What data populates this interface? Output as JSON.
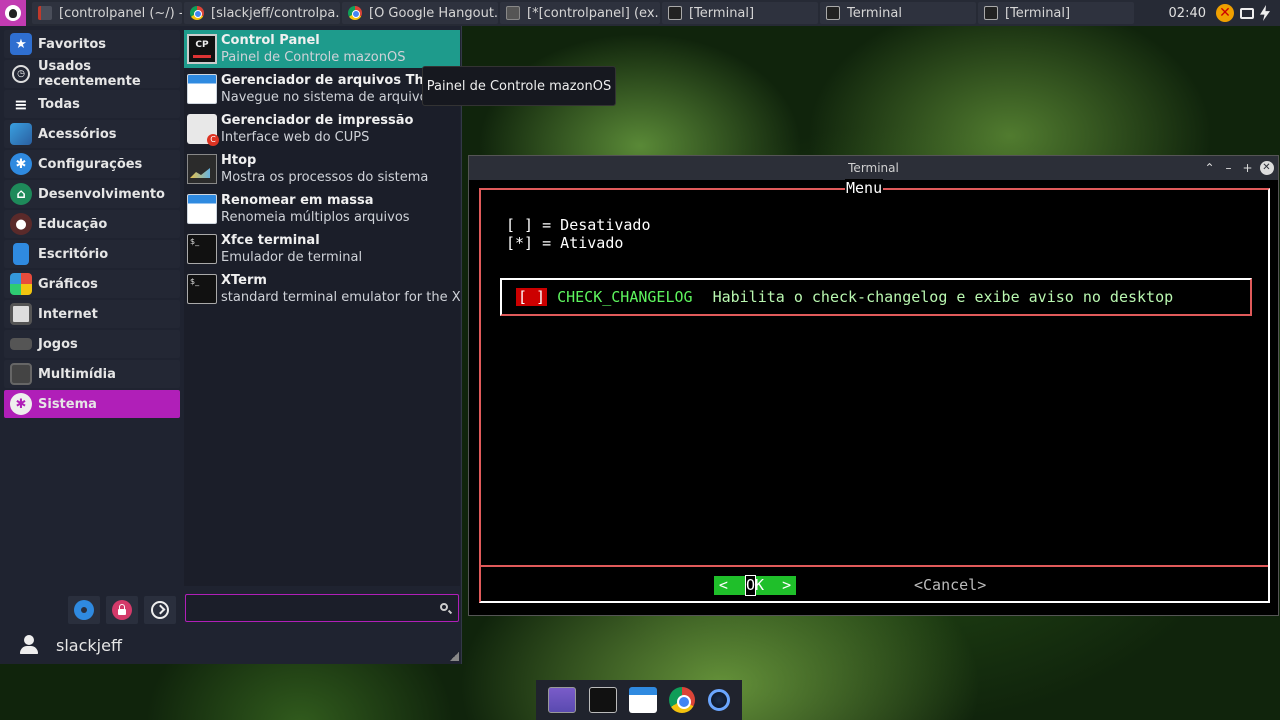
{
  "taskbar": {
    "tasks": [
      {
        "label": "[controlpanel (~/) - ...",
        "icon": "editor-icon"
      },
      {
        "label": "[slackjeff/controlpa...",
        "icon": "chrome-icon"
      },
      {
        "label": "[O Google Hangout...",
        "icon": "chrome-icon"
      },
      {
        "label": "[*[controlpanel] (ex...",
        "icon": "editor-icon"
      },
      {
        "label": "[Terminal]",
        "icon": "terminal-icon"
      },
      {
        "label": "Terminal",
        "icon": "terminal-icon"
      },
      {
        "label": "[Terminal]",
        "icon": "terminal-icon"
      }
    ],
    "clock": "02:40"
  },
  "menu": {
    "categories": [
      {
        "label": "Favoritos",
        "icon": "star-icon"
      },
      {
        "label": "Usados recentemente",
        "icon": "clock-icon"
      },
      {
        "label": "Todas",
        "icon": "list-icon"
      },
      {
        "label": "Acessórios",
        "icon": "accessories-icon"
      },
      {
        "label": "Configurações",
        "icon": "settings-icon"
      },
      {
        "label": "Desenvolvimento",
        "icon": "development-icon"
      },
      {
        "label": "Educação",
        "icon": "education-icon"
      },
      {
        "label": "Escritório",
        "icon": "office-icon"
      },
      {
        "label": "Gráficos",
        "icon": "graphics-icon"
      },
      {
        "label": "Internet",
        "icon": "internet-icon"
      },
      {
        "label": "Jogos",
        "icon": "games-icon"
      },
      {
        "label": "Multimídia",
        "icon": "multimedia-icon"
      },
      {
        "label": "Sistema",
        "icon": "system-icon"
      }
    ],
    "selected_category": "Sistema",
    "apps": [
      {
        "title": "Control Panel",
        "desc": "Painel de Controle mazonOS",
        "icon": "control-panel-icon"
      },
      {
        "title": "Gerenciador de arquivos Thunar",
        "desc": "Navegue no sistema de arquivos co...",
        "icon": "folder-icon"
      },
      {
        "title": "Gerenciador de impressão",
        "desc": "Interface web do CUPS",
        "icon": "printer-icon"
      },
      {
        "title": "Htop",
        "desc": "Mostra os processos do sistema",
        "icon": "htop-icon"
      },
      {
        "title": "Renomear em massa",
        "desc": "Renomeia múltiplos arquivos",
        "icon": "folder-icon"
      },
      {
        "title": "Xfce terminal",
        "desc": "Emulador de terminal",
        "icon": "terminal-icon"
      },
      {
        "title": "XTerm",
        "desc": "standard terminal emulator for the X ...",
        "icon": "terminal-icon"
      }
    ],
    "search_value": "",
    "username": "slackjeff"
  },
  "tooltip": "Painel de Controle mazonOS",
  "terminal": {
    "title": "Terminal",
    "dialog_title": "Menu",
    "legend_off": "[ ] = Desativado",
    "legend_on": "[*] = Ativado",
    "item": {
      "checkbox": "[ ]",
      "name": "CHECK_CHANGELOG",
      "desc": "Habilita o check-changelog e exibe aviso no desktop",
      "checked": false
    },
    "ok_left": "<  ",
    "ok_hotkey": "O",
    "ok_rest": "K  >",
    "cancel": "<Cancel>"
  },
  "colors": {
    "menu_accent": "#b01fb8",
    "app_selected": "#1e9b8c",
    "dialog_border": "#e05a5a",
    "ok_button": "#1fbf2a",
    "item_text": "#5ef55e"
  }
}
